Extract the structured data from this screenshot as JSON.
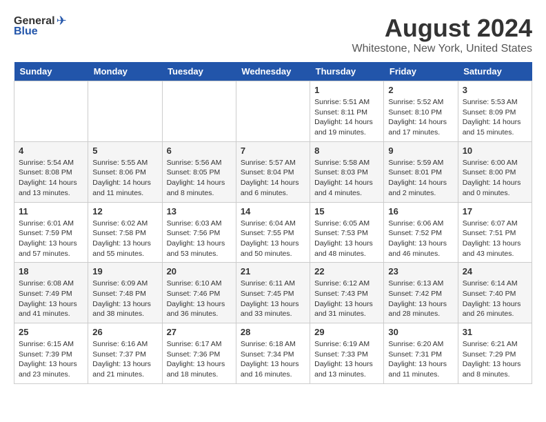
{
  "header": {
    "logo_general": "General",
    "logo_blue": "Blue",
    "title": "August 2024",
    "subtitle": "Whitestone, New York, United States"
  },
  "days_of_week": [
    "Sunday",
    "Monday",
    "Tuesday",
    "Wednesday",
    "Thursday",
    "Friday",
    "Saturday"
  ],
  "weeks": [
    [
      {
        "day": "",
        "info": ""
      },
      {
        "day": "",
        "info": ""
      },
      {
        "day": "",
        "info": ""
      },
      {
        "day": "",
        "info": ""
      },
      {
        "day": "1",
        "info": "Sunrise: 5:51 AM\nSunset: 8:11 PM\nDaylight: 14 hours\nand 19 minutes."
      },
      {
        "day": "2",
        "info": "Sunrise: 5:52 AM\nSunset: 8:10 PM\nDaylight: 14 hours\nand 17 minutes."
      },
      {
        "day": "3",
        "info": "Sunrise: 5:53 AM\nSunset: 8:09 PM\nDaylight: 14 hours\nand 15 minutes."
      }
    ],
    [
      {
        "day": "4",
        "info": "Sunrise: 5:54 AM\nSunset: 8:08 PM\nDaylight: 14 hours\nand 13 minutes."
      },
      {
        "day": "5",
        "info": "Sunrise: 5:55 AM\nSunset: 8:06 PM\nDaylight: 14 hours\nand 11 minutes."
      },
      {
        "day": "6",
        "info": "Sunrise: 5:56 AM\nSunset: 8:05 PM\nDaylight: 14 hours\nand 8 minutes."
      },
      {
        "day": "7",
        "info": "Sunrise: 5:57 AM\nSunset: 8:04 PM\nDaylight: 14 hours\nand 6 minutes."
      },
      {
        "day": "8",
        "info": "Sunrise: 5:58 AM\nSunset: 8:03 PM\nDaylight: 14 hours\nand 4 minutes."
      },
      {
        "day": "9",
        "info": "Sunrise: 5:59 AM\nSunset: 8:01 PM\nDaylight: 14 hours\nand 2 minutes."
      },
      {
        "day": "10",
        "info": "Sunrise: 6:00 AM\nSunset: 8:00 PM\nDaylight: 14 hours\nand 0 minutes."
      }
    ],
    [
      {
        "day": "11",
        "info": "Sunrise: 6:01 AM\nSunset: 7:59 PM\nDaylight: 13 hours\nand 57 minutes."
      },
      {
        "day": "12",
        "info": "Sunrise: 6:02 AM\nSunset: 7:58 PM\nDaylight: 13 hours\nand 55 minutes."
      },
      {
        "day": "13",
        "info": "Sunrise: 6:03 AM\nSunset: 7:56 PM\nDaylight: 13 hours\nand 53 minutes."
      },
      {
        "day": "14",
        "info": "Sunrise: 6:04 AM\nSunset: 7:55 PM\nDaylight: 13 hours\nand 50 minutes."
      },
      {
        "day": "15",
        "info": "Sunrise: 6:05 AM\nSunset: 7:53 PM\nDaylight: 13 hours\nand 48 minutes."
      },
      {
        "day": "16",
        "info": "Sunrise: 6:06 AM\nSunset: 7:52 PM\nDaylight: 13 hours\nand 46 minutes."
      },
      {
        "day": "17",
        "info": "Sunrise: 6:07 AM\nSunset: 7:51 PM\nDaylight: 13 hours\nand 43 minutes."
      }
    ],
    [
      {
        "day": "18",
        "info": "Sunrise: 6:08 AM\nSunset: 7:49 PM\nDaylight: 13 hours\nand 41 minutes."
      },
      {
        "day": "19",
        "info": "Sunrise: 6:09 AM\nSunset: 7:48 PM\nDaylight: 13 hours\nand 38 minutes."
      },
      {
        "day": "20",
        "info": "Sunrise: 6:10 AM\nSunset: 7:46 PM\nDaylight: 13 hours\nand 36 minutes."
      },
      {
        "day": "21",
        "info": "Sunrise: 6:11 AM\nSunset: 7:45 PM\nDaylight: 13 hours\nand 33 minutes."
      },
      {
        "day": "22",
        "info": "Sunrise: 6:12 AM\nSunset: 7:43 PM\nDaylight: 13 hours\nand 31 minutes."
      },
      {
        "day": "23",
        "info": "Sunrise: 6:13 AM\nSunset: 7:42 PM\nDaylight: 13 hours\nand 28 minutes."
      },
      {
        "day": "24",
        "info": "Sunrise: 6:14 AM\nSunset: 7:40 PM\nDaylight: 13 hours\nand 26 minutes."
      }
    ],
    [
      {
        "day": "25",
        "info": "Sunrise: 6:15 AM\nSunset: 7:39 PM\nDaylight: 13 hours\nand 23 minutes."
      },
      {
        "day": "26",
        "info": "Sunrise: 6:16 AM\nSunset: 7:37 PM\nDaylight: 13 hours\nand 21 minutes."
      },
      {
        "day": "27",
        "info": "Sunrise: 6:17 AM\nSunset: 7:36 PM\nDaylight: 13 hours\nand 18 minutes."
      },
      {
        "day": "28",
        "info": "Sunrise: 6:18 AM\nSunset: 7:34 PM\nDaylight: 13 hours\nand 16 minutes."
      },
      {
        "day": "29",
        "info": "Sunrise: 6:19 AM\nSunset: 7:33 PM\nDaylight: 13 hours\nand 13 minutes."
      },
      {
        "day": "30",
        "info": "Sunrise: 6:20 AM\nSunset: 7:31 PM\nDaylight: 13 hours\nand 11 minutes."
      },
      {
        "day": "31",
        "info": "Sunrise: 6:21 AM\nSunset: 7:29 PM\nDaylight: 13 hours\nand 8 minutes."
      }
    ]
  ]
}
